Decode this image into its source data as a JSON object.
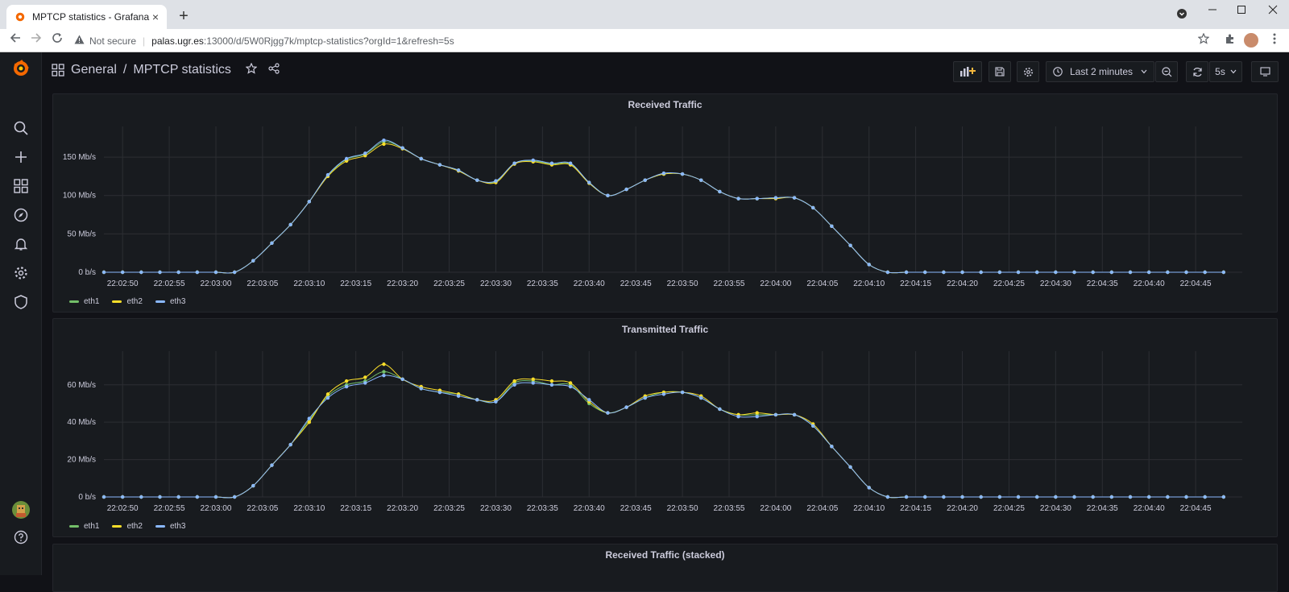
{
  "browser": {
    "tab_title": "MPTCP statistics - Grafana",
    "close_glyph": "×",
    "new_tab_glyph": "+",
    "not_secure": "Not secure",
    "url_host": "palas.ugr.es",
    "url_path": ":13000/d/5W0Rjgg7k/mptcp-statistics?orgId=1&refresh=5s"
  },
  "grafana": {
    "breadcrumb_folder": "General",
    "breadcrumb_sep": "/",
    "dashboard_title": "MPTCP statistics",
    "time_range": "Last 2 minutes",
    "refresh_interval": "5s",
    "next_panel_title": "Received Traffic (stacked)"
  },
  "colors": {
    "eth1": "#73bf69",
    "eth2": "#fade2a",
    "eth3": "#8ab8ff",
    "bg": "#111217",
    "panel": "#181b1f"
  },
  "chart_data": [
    {
      "type": "line",
      "title": "Received Traffic",
      "x_ticks": [
        "22:02:50",
        "22:02:55",
        "22:03:00",
        "22:03:05",
        "22:03:10",
        "22:03:15",
        "22:03:20",
        "22:03:25",
        "22:03:30",
        "22:03:35",
        "22:03:40",
        "22:03:45",
        "22:03:50",
        "22:03:55",
        "22:04:00",
        "22:04:05",
        "22:04:10",
        "22:04:15",
        "22:04:20",
        "22:04:25",
        "22:04:30",
        "22:04:35",
        "22:04:40",
        "22:04:45"
      ],
      "y_ticks": [
        "0 b/s",
        "50 Mb/s",
        "100 Mb/s",
        "150 Mb/s"
      ],
      "ylim": [
        0,
        190
      ],
      "x_start": "22:02:48",
      "x_step_seconds": 2,
      "series": [
        {
          "name": "eth1",
          "color": "#73bf69",
          "values": [
            0,
            0,
            0,
            0,
            0,
            0,
            0,
            0,
            15,
            38,
            62,
            92,
            126,
            147,
            154,
            170,
            162,
            148,
            140,
            133,
            120,
            118,
            142,
            145,
            141,
            141,
            117,
            100,
            108,
            120,
            128,
            128,
            120,
            105,
            96,
            96,
            97,
            97,
            84,
            60,
            35,
            10,
            0,
            0,
            0,
            0,
            0,
            0,
            0,
            0,
            0,
            0,
            0,
            0,
            0,
            0,
            0,
            0,
            0,
            0,
            0
          ]
        },
        {
          "name": "eth2",
          "color": "#fade2a",
          "values": [
            0,
            0,
            0,
            0,
            0,
            0,
            0,
            0,
            15,
            38,
            62,
            92,
            125,
            145,
            152,
            167,
            161,
            148,
            140,
            132,
            120,
            117,
            141,
            144,
            140,
            140,
            116,
            100,
            108,
            120,
            128,
            128,
            120,
            105,
            96,
            96,
            96,
            97,
            84,
            60,
            35,
            10,
            0,
            0,
            0,
            0,
            0,
            0,
            0,
            0,
            0,
            0,
            0,
            0,
            0,
            0,
            0,
            0,
            0,
            0,
            0
          ]
        },
        {
          "name": "eth3",
          "color": "#8ab8ff",
          "values": [
            0,
            0,
            0,
            0,
            0,
            0,
            0,
            0,
            15,
            38,
            62,
            92,
            127,
            148,
            155,
            172,
            162,
            148,
            140,
            133,
            120,
            119,
            142,
            146,
            142,
            142,
            117,
            100,
            108,
            120,
            129,
            128,
            120,
            105,
            96,
            96,
            97,
            97,
            84,
            60,
            35,
            10,
            0,
            0,
            0,
            0,
            0,
            0,
            0,
            0,
            0,
            0,
            0,
            0,
            0,
            0,
            0,
            0,
            0,
            0,
            0
          ]
        }
      ],
      "legend": [
        "eth1",
        "eth2",
        "eth3"
      ]
    },
    {
      "type": "line",
      "title": "Transmitted Traffic",
      "x_ticks": [
        "22:02:50",
        "22:02:55",
        "22:03:00",
        "22:03:05",
        "22:03:10",
        "22:03:15",
        "22:03:20",
        "22:03:25",
        "22:03:30",
        "22:03:35",
        "22:03:40",
        "22:03:45",
        "22:03:50",
        "22:03:55",
        "22:04:00",
        "22:04:05",
        "22:04:10",
        "22:04:15",
        "22:04:20",
        "22:04:25",
        "22:04:30",
        "22:04:35",
        "22:04:40",
        "22:04:45"
      ],
      "y_ticks": [
        "0 b/s",
        "20 Mb/s",
        "40 Mb/s",
        "60 Mb/s"
      ],
      "ylim": [
        0,
        78
      ],
      "x_start": "22:02:48",
      "x_step_seconds": 2,
      "series": [
        {
          "name": "eth1",
          "color": "#73bf69",
          "values": [
            0,
            0,
            0,
            0,
            0,
            0,
            0,
            0,
            6,
            17,
            28,
            41,
            54,
            60,
            62,
            67,
            63,
            58,
            56,
            55,
            52,
            51,
            61,
            62,
            60,
            60,
            50,
            45,
            48,
            53,
            56,
            56,
            53,
            47,
            44,
            44,
            44,
            44,
            38,
            27,
            16,
            5,
            0,
            0,
            0,
            0,
            0,
            0,
            0,
            0,
            0,
            0,
            0,
            0,
            0,
            0,
            0,
            0,
            0,
            0,
            0
          ]
        },
        {
          "name": "eth2",
          "color": "#fade2a",
          "values": [
            0,
            0,
            0,
            0,
            0,
            0,
            0,
            0,
            6,
            17,
            28,
            40,
            55,
            62,
            64,
            71,
            63,
            59,
            57,
            55,
            52,
            52,
            62,
            63,
            62,
            61,
            51,
            45,
            48,
            54,
            56,
            56,
            54,
            47,
            44,
            45,
            44,
            44,
            39,
            27,
            16,
            5,
            0,
            0,
            0,
            0,
            0,
            0,
            0,
            0,
            0,
            0,
            0,
            0,
            0,
            0,
            0,
            0,
            0,
            0,
            0
          ]
        },
        {
          "name": "eth3",
          "color": "#8ab8ff",
          "values": [
            0,
            0,
            0,
            0,
            0,
            0,
            0,
            0,
            6,
            17,
            28,
            42,
            53,
            59,
            61,
            65,
            63,
            58,
            56,
            54,
            52,
            51,
            60,
            61,
            60,
            59,
            52,
            45,
            48,
            53,
            55,
            56,
            53,
            47,
            43,
            43,
            44,
            44,
            38,
            27,
            16,
            5,
            0,
            0,
            0,
            0,
            0,
            0,
            0,
            0,
            0,
            0,
            0,
            0,
            0,
            0,
            0,
            0,
            0,
            0,
            0
          ]
        }
      ],
      "legend": [
        "eth1",
        "eth2",
        "eth3"
      ]
    }
  ]
}
